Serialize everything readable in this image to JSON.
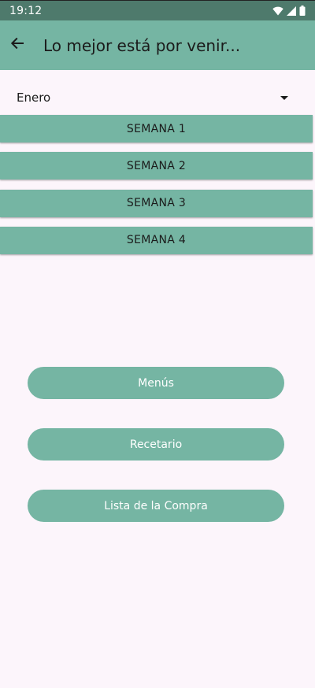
{
  "status_bar": {
    "time": "19:12",
    "icons": [
      "wifi-icon",
      "signal-icon",
      "battery-icon"
    ]
  },
  "app_bar": {
    "back_icon": "arrow-left-icon",
    "title": "Lo mejor está por venir..."
  },
  "month_select": {
    "selected": "Enero",
    "icon": "dropdown-arrow-icon"
  },
  "weeks": [
    {
      "label": "SEMANA 1"
    },
    {
      "label": "SEMANA 2"
    },
    {
      "label": "SEMANA 3"
    },
    {
      "label": "SEMANA 4"
    }
  ],
  "actions": [
    {
      "label": "Menús"
    },
    {
      "label": "Recetario"
    },
    {
      "label": "Lista de la Compra"
    }
  ],
  "colors": {
    "primary": "#75b5a3",
    "status_bar": "#4e7a6c",
    "background": "#fcf5fb",
    "text": "#1b1b1b",
    "button_text": "#ffffff"
  }
}
